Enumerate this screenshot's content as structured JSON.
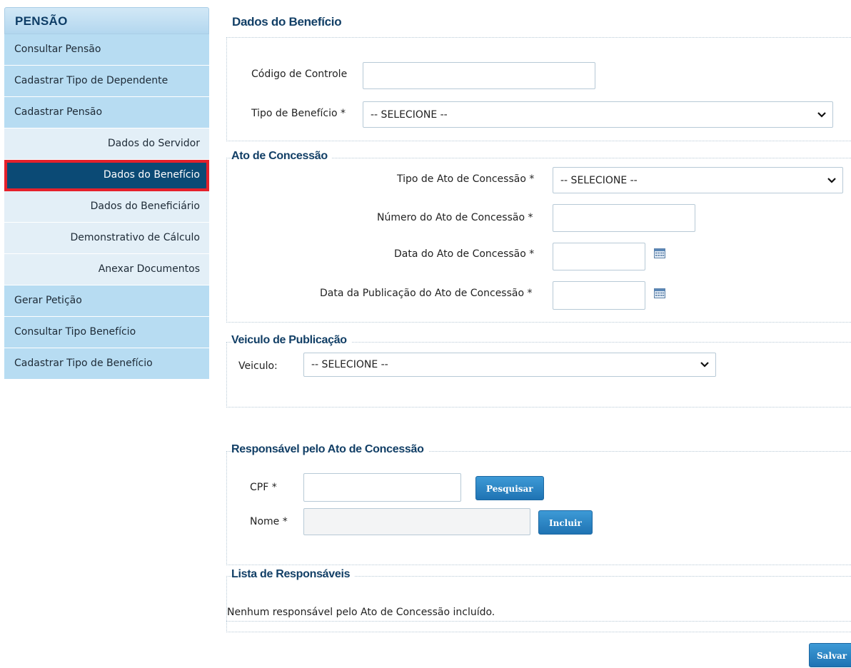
{
  "sidebar": {
    "header": "PENSÃO",
    "items": [
      {
        "label": "Consultar Pensão"
      },
      {
        "label": "Cadastrar Tipo de Dependente"
      },
      {
        "label": "Cadastrar Pensão"
      },
      {
        "label": "Dados do Servidor"
      },
      {
        "label": "Dados do Benefício"
      },
      {
        "label": "Dados do Beneficiário"
      },
      {
        "label": "Demonstrativo de Cálculo"
      },
      {
        "label": "Anexar Documentos"
      },
      {
        "label": "Gerar Petição"
      },
      {
        "label": "Consultar Tipo Benefício"
      },
      {
        "label": "Cadastrar Tipo de Benefício"
      }
    ],
    "active_item": "Dados do Benefício"
  },
  "main": {
    "title": "Dados do Benefício",
    "beneficio": {
      "codigo_label": "Código de Controle",
      "codigo_value": "",
      "tipo_label": "Tipo de Benefício *",
      "tipo_value": "-- SELECIONE --"
    },
    "ato": {
      "legend": "Ato de Concessão",
      "tipo_label": "Tipo de Ato de Concessão *",
      "tipo_value": "-- SELECIONE --",
      "numero_label": "Número do Ato de Concessão *",
      "data_label": "Data do Ato de Concessão *",
      "data_pub_label": "Data da Publicação do Ato de Concessão *"
    },
    "veiculo": {
      "legend": "Veiculo de Publicação",
      "label": "Veiculo:",
      "value": "-- SELECIONE --"
    },
    "responsavel": {
      "legend": "Responsável pelo Ato de Concessão",
      "cpf_label": "CPF *",
      "nome_label": "Nome *",
      "pesquisar": "Pesquisar",
      "incluir": "Incluir"
    },
    "lista": {
      "legend": "Lista de Responsáveis",
      "empty_text": "Nenhum responsável pelo Ato de Concessão incluído."
    },
    "salvar": "Salvar"
  },
  "icons": {
    "calendar": "calendar-icon",
    "chevron": "chevron-down-icon"
  },
  "colors": {
    "active_bg": "#0b4a75",
    "highlight_border": "#e5212b",
    "button": "#2a86c7",
    "heading": "#123f66"
  }
}
